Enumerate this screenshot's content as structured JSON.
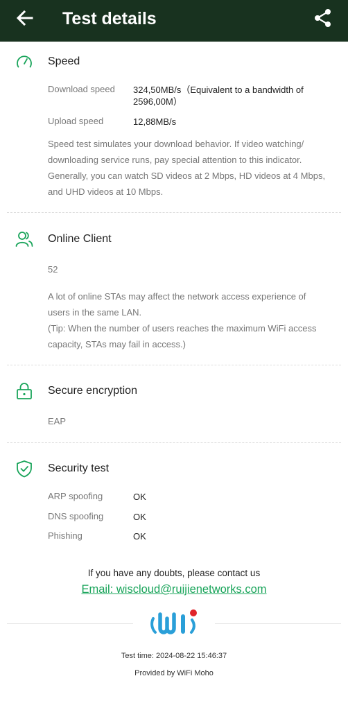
{
  "header": {
    "title": "Test details",
    "back_icon": "arrow-left-icon",
    "share_icon": "share-icon"
  },
  "sections": {
    "speed": {
      "title": "Speed",
      "icon": "speedometer-icon",
      "rows": [
        {
          "label": "Download speed",
          "value_line1": "324,50MB/s（Equivalent to a bandwidth of",
          "value_line2": "2596,00M）"
        },
        {
          "label": "Upload speed",
          "value_line1": "12,88MB/s"
        }
      ],
      "description": [
        "Speed test simulates your download behavior. If video watching/",
        "downloading service runs, pay special attention to this indicator.",
        "Generally, you can watch SD videos at 2 Mbps, HD videos at 4 Mbps,",
        "and UHD videos at 10 Mbps."
      ]
    },
    "online_client": {
      "title": "Online Client",
      "icon": "users-icon",
      "count": "52",
      "description": [
        "A lot of online STAs may affect the network access experience of",
        "users in the same LAN.",
        "(Tip: When the number of users reaches the maximum WiFi access",
        "capacity, STAs may fail in access.)"
      ]
    },
    "encryption": {
      "title": "Secure encryption",
      "icon": "lock-icon",
      "value": "EAP"
    },
    "security": {
      "title": "Security test",
      "icon": "shield-check-icon",
      "rows": [
        {
          "label": "ARP spoofing",
          "value": "OK"
        },
        {
          "label": "DNS spoofing",
          "value": "OK"
        },
        {
          "label": "Phishing",
          "value": "OK"
        }
      ]
    }
  },
  "contact": {
    "text": "If you have any doubts, please contact us",
    "email": "Email: wiscloud@ruijienetworks.com"
  },
  "footer": {
    "test_time": "Test time: 2024-08-22 15:46:37",
    "provided_by": "Provided by WiFi Moho",
    "logo_icon": "wifi-moho-logo"
  },
  "colors": {
    "header_bg": "#18321f",
    "accent": "#19a45a",
    "logo_blue": "#2a9fd8",
    "logo_red": "#e0242a"
  }
}
